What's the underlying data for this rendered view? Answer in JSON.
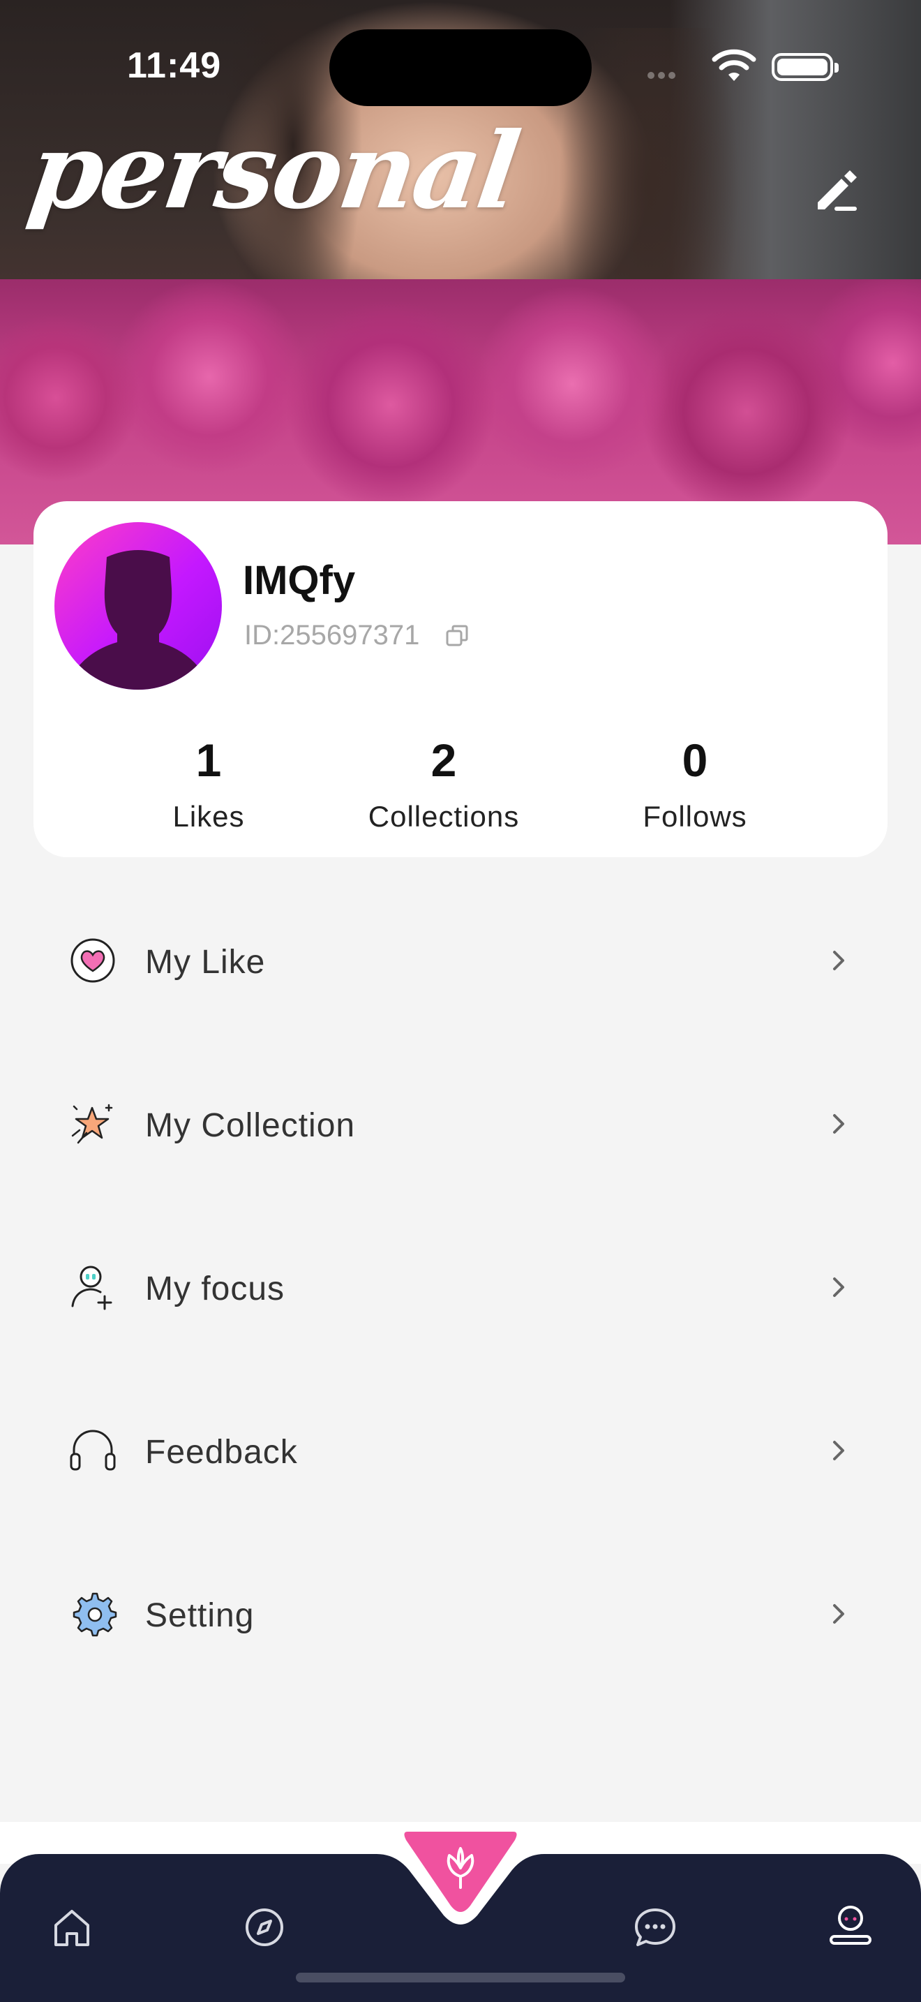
{
  "status_bar": {
    "time": "11:49"
  },
  "header": {
    "title": "personal"
  },
  "profile": {
    "username": "IMQfy",
    "id_text": "ID:255697371",
    "stats": [
      {
        "value": "1",
        "label": "Likes"
      },
      {
        "value": "2",
        "label": "Collections"
      },
      {
        "value": "0",
        "label": "Follows"
      }
    ]
  },
  "menu": {
    "items": [
      {
        "label": "My Like",
        "icon": "heart-icon"
      },
      {
        "label": "My Collection",
        "icon": "star-icon"
      },
      {
        "label": "My focus",
        "icon": "user-add-icon"
      },
      {
        "label": "Feedback",
        "icon": "headphones-icon"
      },
      {
        "label": "Setting",
        "icon": "gear-icon"
      }
    ]
  },
  "tabbar": {
    "items": [
      {
        "icon": "home-icon"
      },
      {
        "icon": "compass-icon"
      },
      {
        "icon": "flower-icon"
      },
      {
        "icon": "chat-icon"
      },
      {
        "icon": "profile-icon"
      }
    ],
    "active": "profile-icon"
  },
  "colors": {
    "accent": "#f0529f",
    "tabbar": "#1a1f38",
    "avatar_gradient": [
      "#ff3ec6",
      "#9b10f0"
    ]
  }
}
